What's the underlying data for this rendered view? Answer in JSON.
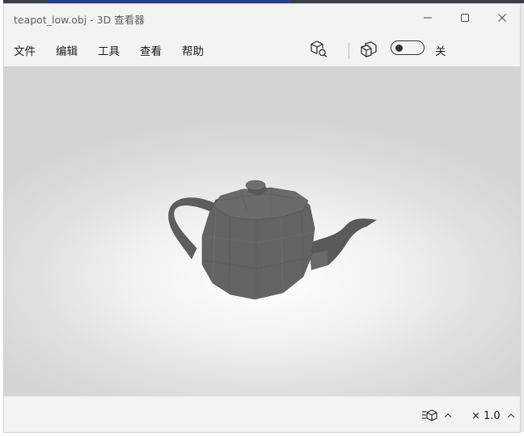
{
  "window": {
    "title": "teapot_low.obj - 3D 查看器"
  },
  "menu": {
    "items": [
      "文件",
      "编辑",
      "工具",
      "查看",
      "帮助"
    ]
  },
  "toolbar": {
    "icons": [
      "cube-search-icon",
      "wireframe-cube-icon"
    ],
    "toggle_state": "off",
    "toggle_label": "关"
  },
  "viewport": {
    "model": "teapot"
  },
  "status": {
    "zoom": "× 1.0",
    "view_mode_icon": "layered-cube-icon"
  },
  "colors": {
    "window_bg": "#f3f3f3",
    "model_fill": "#616161",
    "accent_bar": "#2b3d8f"
  }
}
